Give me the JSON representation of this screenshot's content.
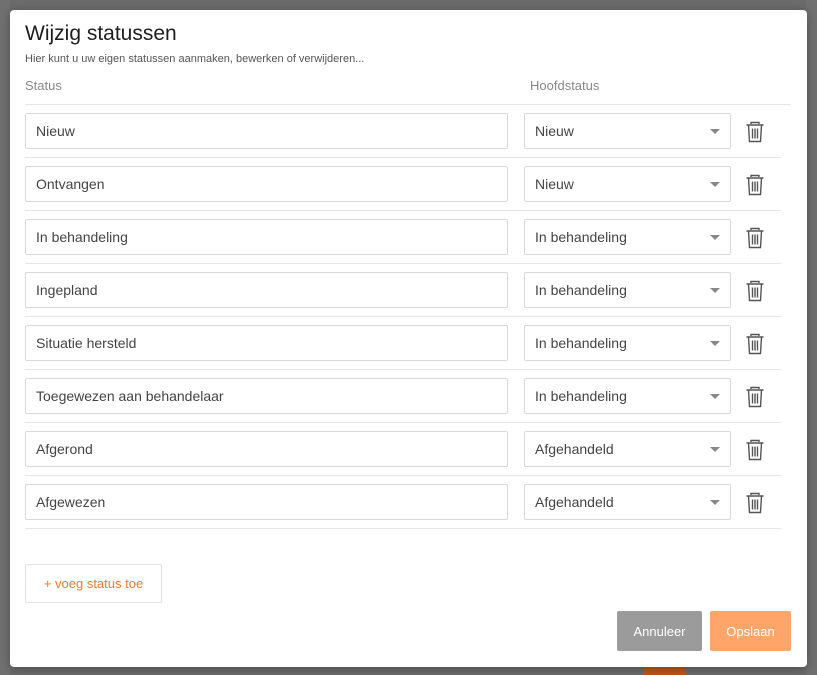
{
  "modal": {
    "title": "Wijzig statussen",
    "subtitle": "Hier kunt u uw eigen statussen aanmaken, bewerken of verwijderen...",
    "columns": {
      "status": "Status",
      "main_status": "Hoofdstatus"
    },
    "rows": [
      {
        "status": "Nieuw",
        "main_status": "Nieuw"
      },
      {
        "status": "Ontvangen",
        "main_status": "Nieuw"
      },
      {
        "status": "In behandeling",
        "main_status": "In behandeling"
      },
      {
        "status": "Ingepland",
        "main_status": "In behandeling"
      },
      {
        "status": "Situatie hersteld",
        "main_status": "In behandeling"
      },
      {
        "status": "Toegewezen aan behandelaar",
        "main_status": "In behandeling"
      },
      {
        "status": "Afgerond",
        "main_status": "Afgehandeld"
      },
      {
        "status": "Afgewezen",
        "main_status": "Afgehandeld"
      }
    ],
    "add_button": "+ voeg status toe",
    "cancel_button": "Annuleer",
    "save_button": "Opslaan"
  },
  "colors": {
    "accent": "#f07a2a",
    "save_button_bg": "#ffa56a",
    "cancel_button_bg": "#9b9b9b"
  },
  "icons": {
    "delete": "trash-icon",
    "dropdown": "chevron-down-icon"
  }
}
